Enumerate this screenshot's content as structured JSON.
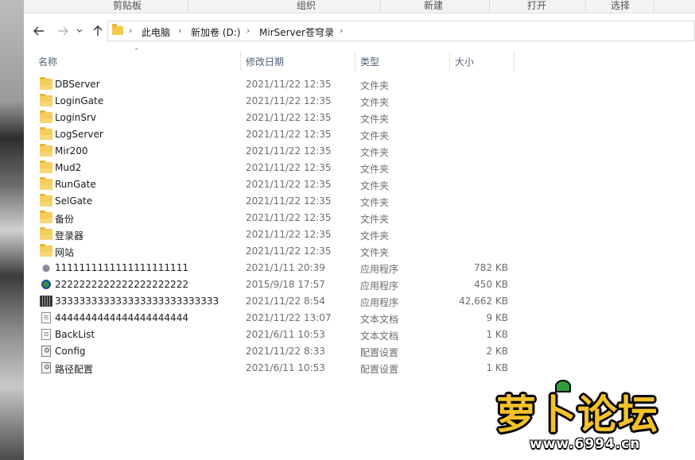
{
  "ribbon": {
    "groups": [
      "剪贴板",
      "组织",
      "新建",
      "打开",
      "选择"
    ]
  },
  "nav": {
    "back_icon": "arrow-left",
    "forward_icon": "arrow-right",
    "recent_icon": "chevron-down",
    "up_icon": "arrow-up"
  },
  "address": {
    "crumbs": [
      "此电脑",
      "新加卷 (D:)",
      "MirServer苍穹录"
    ]
  },
  "columns": {
    "name": "名称",
    "modified": "修改日期",
    "type": "类型",
    "size": "大小"
  },
  "files": [
    {
      "name": "DBServer",
      "date": "2021/11/22 12:35",
      "type": "文件夹",
      "size": "",
      "icon": "folder-icon"
    },
    {
      "name": "LoginGate",
      "date": "2021/11/22 12:35",
      "type": "文件夹",
      "size": "",
      "icon": "folder-icon"
    },
    {
      "name": "LoginSrv",
      "date": "2021/11/22 12:35",
      "type": "文件夹",
      "size": "",
      "icon": "folder-icon"
    },
    {
      "name": "LogServer",
      "date": "2021/11/22 12:35",
      "type": "文件夹",
      "size": "",
      "icon": "folder-icon"
    },
    {
      "name": "Mir200",
      "date": "2021/11/22 12:35",
      "type": "文件夹",
      "size": "",
      "icon": "folder-icon"
    },
    {
      "name": "Mud2",
      "date": "2021/11/22 12:35",
      "type": "文件夹",
      "size": "",
      "icon": "folder-icon"
    },
    {
      "name": "RunGate",
      "date": "2021/11/22 12:35",
      "type": "文件夹",
      "size": "",
      "icon": "folder-icon"
    },
    {
      "name": "SelGate",
      "date": "2021/11/22 12:35",
      "type": "文件夹",
      "size": "",
      "icon": "folder-icon"
    },
    {
      "name": "备份",
      "date": "2021/11/22 12:35",
      "type": "文件夹",
      "size": "",
      "icon": "folder-icon"
    },
    {
      "name": "登录器",
      "date": "2021/11/22 12:35",
      "type": "文件夹",
      "size": "",
      "icon": "folder-icon"
    },
    {
      "name": "网站",
      "date": "2021/11/22 12:35",
      "type": "文件夹",
      "size": "",
      "icon": "folder-icon"
    },
    {
      "name": "1111111111111111111111",
      "date": "2021/1/11 20:39",
      "type": "应用程序",
      "size": "782 KB",
      "icon": "app-icon-1"
    },
    {
      "name": "2222222222222222222222",
      "date": "2015/9/18 17:57",
      "type": "应用程序",
      "size": "450 KB",
      "icon": "app-icon-2"
    },
    {
      "name": "333333333333333333333333333",
      "date": "2021/11/22 8:54",
      "type": "应用程序",
      "size": "42,662 KB",
      "icon": "app-icon-3"
    },
    {
      "name": "4444444444444444444444",
      "date": "2021/11/22 13:07",
      "type": "文本文档",
      "size": "9 KB",
      "icon": "text-doc-icon"
    },
    {
      "name": "BackList",
      "date": "2021/6/11 10:53",
      "type": "文本文档",
      "size": "1 KB",
      "icon": "text-doc-icon"
    },
    {
      "name": "Config",
      "date": "2021/11/22 8:33",
      "type": "配置设置",
      "size": "2 KB",
      "icon": "config-icon"
    },
    {
      "name": "路径配置",
      "date": "2021/6/11 10:53",
      "type": "配置设置",
      "size": "1 KB",
      "icon": "config-icon"
    }
  ],
  "watermark": {
    "text": "萝卜论坛",
    "url": "www.6994.cn"
  }
}
